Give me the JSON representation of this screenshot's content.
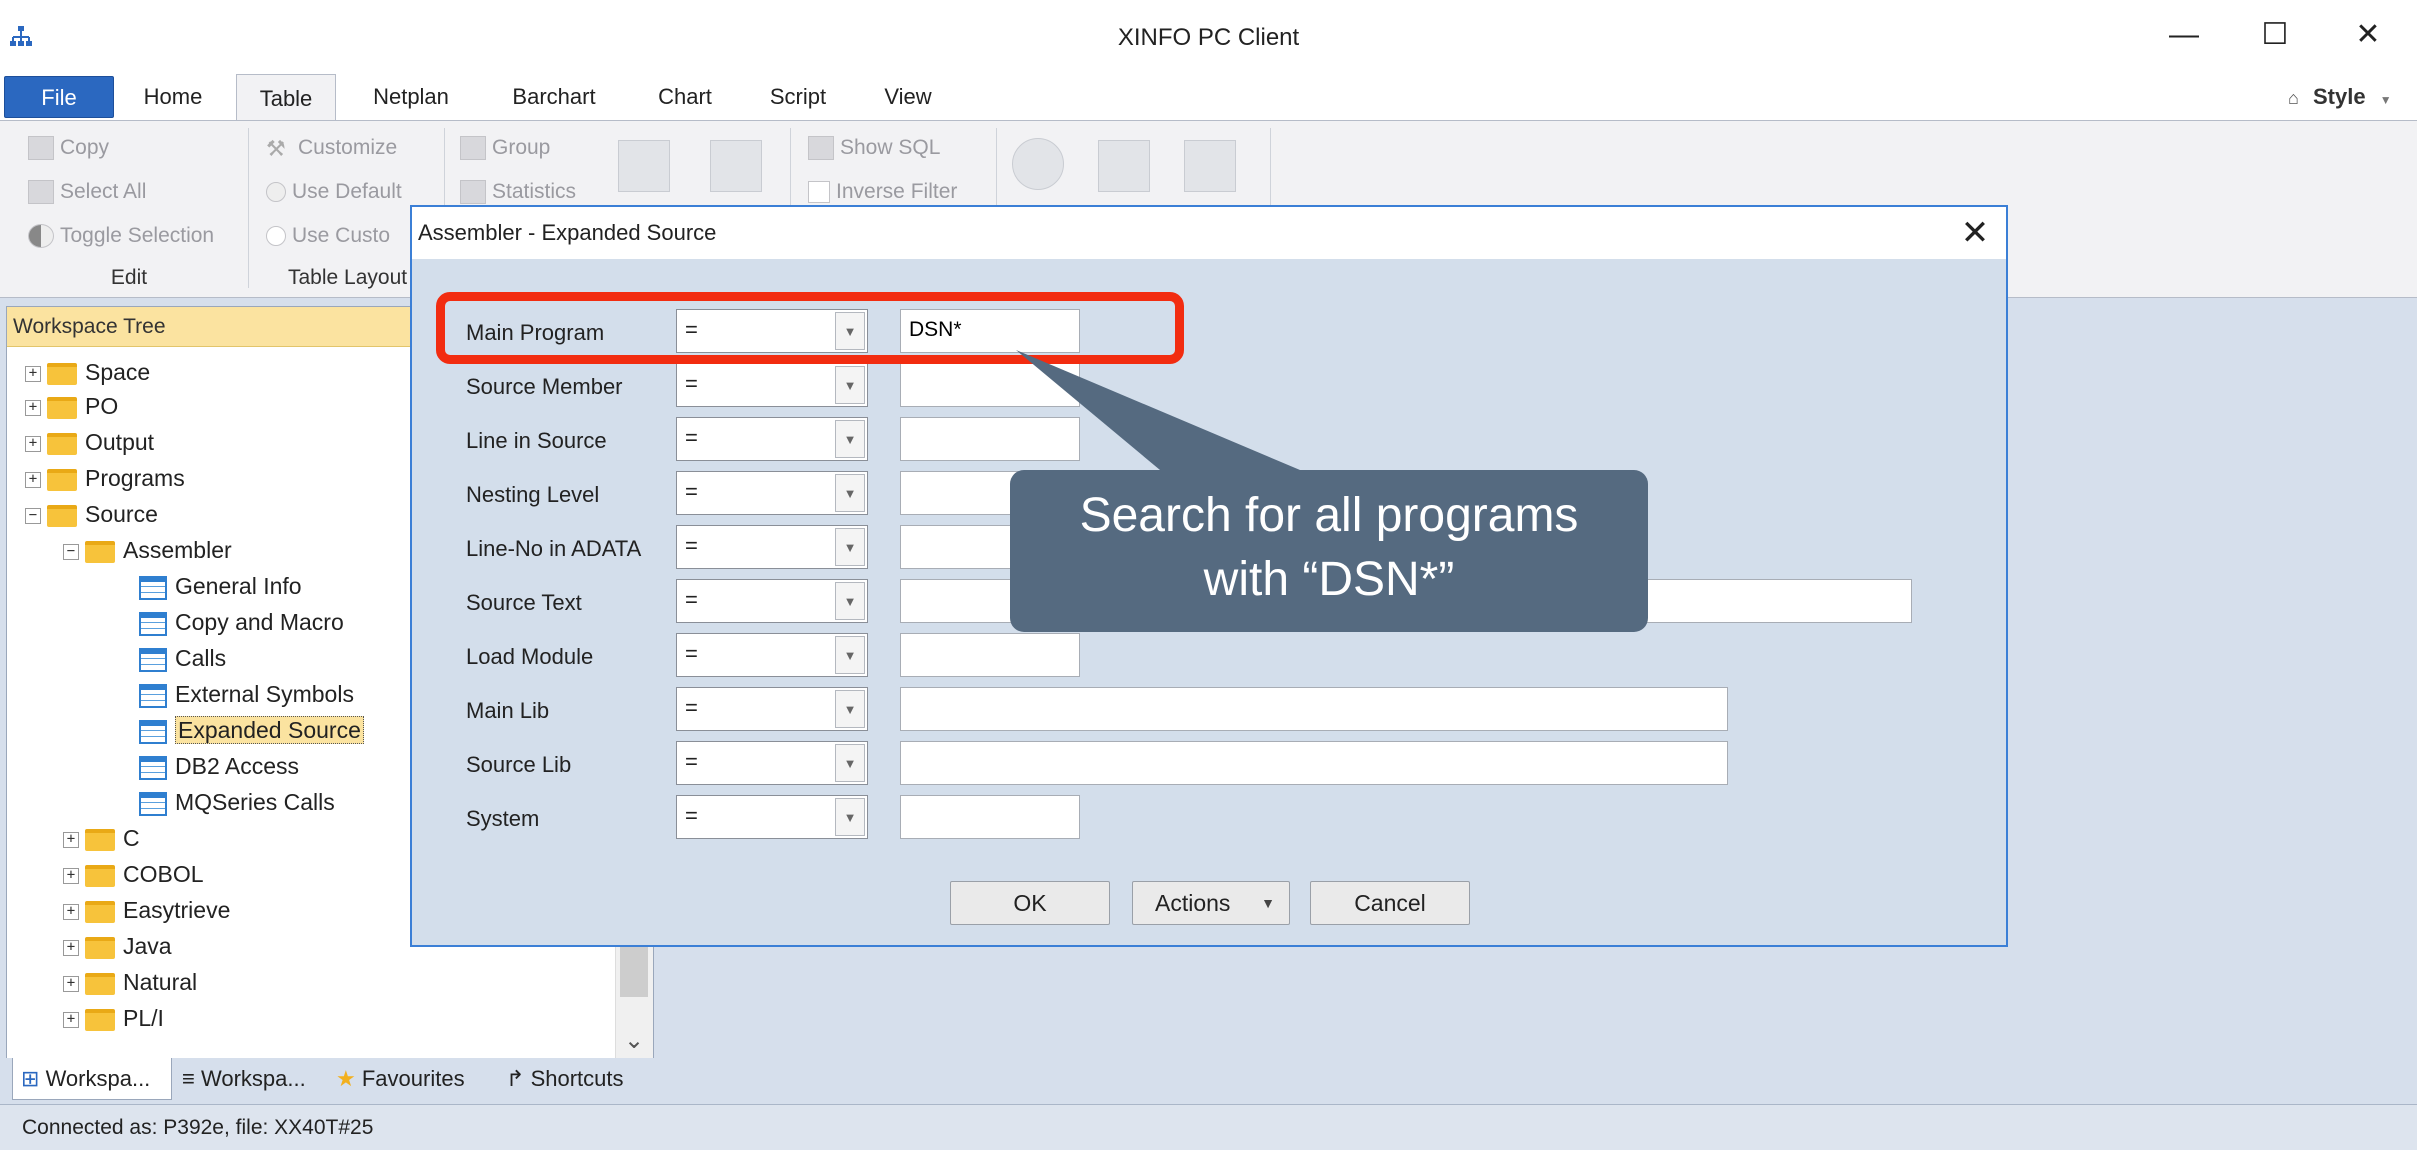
{
  "window": {
    "title": "XINFO PC Client",
    "minimize": "—",
    "maximize": "☐",
    "close": "✕"
  },
  "ribbon_tabs": [
    "File",
    "Home",
    "Table",
    "Netplan",
    "Barchart",
    "Chart",
    "Script",
    "View"
  ],
  "style_menu": "Style",
  "ribbon": {
    "edit": {
      "copy": "Copy",
      "select_all": "Select All",
      "toggle_selection": "Toggle Selection",
      "label": "Edit"
    },
    "table_layout": {
      "customize": "Customize",
      "use_default": "Use Default",
      "use_custom": "Use Custo",
      "label": "Table Layout"
    },
    "group": "Group",
    "statistics": "Statistics",
    "show_sql": "Show SQL",
    "inverse_filter": "Inverse Filter"
  },
  "workspace_tree": {
    "header": "Workspace Tree",
    "nodes": [
      {
        "label": "Space",
        "pm": "+"
      },
      {
        "label": "PO",
        "pm": "+"
      },
      {
        "label": "Output",
        "pm": "+"
      },
      {
        "label": "Programs",
        "pm": "+"
      },
      {
        "label": "Source",
        "pm": "−"
      },
      {
        "label": "Assembler",
        "pm": "−"
      },
      {
        "label": "General Info"
      },
      {
        "label": "Copy and Macro"
      },
      {
        "label": "Calls"
      },
      {
        "label": "External Symbols"
      },
      {
        "label": "Expanded Source"
      },
      {
        "label": "DB2 Access"
      },
      {
        "label": "MQSeries Calls"
      },
      {
        "label": "C",
        "pm": "+"
      },
      {
        "label": "COBOL",
        "pm": "+"
      },
      {
        "label": "Easytrieve",
        "pm": "+"
      },
      {
        "label": "Java",
        "pm": "+"
      },
      {
        "label": "Natural",
        "pm": "+"
      },
      {
        "label": "PL/I",
        "pm": "+"
      }
    ],
    "scroll_down": "⌄"
  },
  "bottom_tabs": [
    "Workspa...",
    "Workspa...",
    "Favourites",
    "Shortcuts"
  ],
  "status": "Connected as: P392e, file: XX40T#25",
  "dialog": {
    "title": "Assembler - Expanded Source",
    "close": "✕",
    "fields": [
      {
        "label": "Main Program",
        "op": "=",
        "value": "DSN*"
      },
      {
        "label": "Source Member",
        "op": "=",
        "value": ""
      },
      {
        "label": "Line in Source",
        "op": "=",
        "value": ""
      },
      {
        "label": "Nesting Level",
        "op": "=",
        "value": ""
      },
      {
        "label": "Line-No in ADATA",
        "op": "=",
        "value": ""
      },
      {
        "label": "Source Text",
        "op": "=",
        "value": ""
      },
      {
        "label": "Load Module",
        "op": "=",
        "value": ""
      },
      {
        "label": "Main Lib",
        "op": "=",
        "value": ""
      },
      {
        "label": "Source Lib",
        "op": "=",
        "value": ""
      },
      {
        "label": "System",
        "op": "=",
        "value": ""
      }
    ],
    "ok": "OK",
    "actions": "Actions",
    "cancel": "Cancel"
  },
  "callout": {
    "line1": "Search for all programs",
    "line2": "with “DSN*”"
  }
}
